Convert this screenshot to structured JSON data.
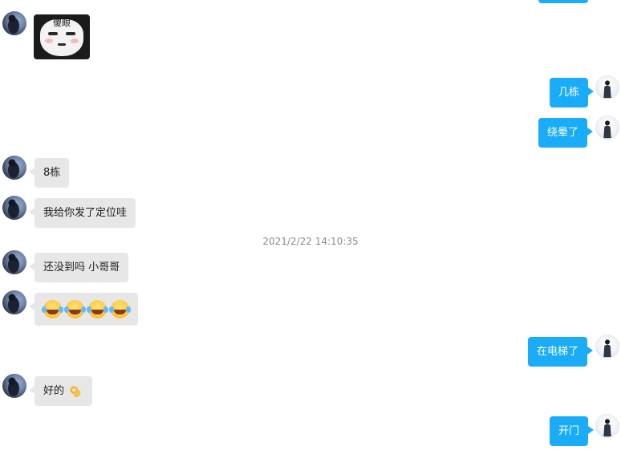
{
  "messages": {
    "m1_sticker_text": "傻眼",
    "m2_text": "几栋",
    "m3_text": "绕晕了",
    "m4_text": "8栋",
    "m5_text": "我给你发了定位哇",
    "timestamp": "2021/2/22 14:10:35",
    "m6_text": "还没到吗 小哥哥",
    "m7_emoji_count": 4,
    "m8_text": "在电梯了",
    "m9_text": "好的",
    "m10_text": "开门"
  },
  "colors": {
    "outgoing_bubble": "#1aacf6",
    "incoming_bubble": "#e7e7e7",
    "timestamp_text": "#8a8a8a"
  },
  "icons": {
    "avatar_incoming": "dark-blue-avatar",
    "avatar_outgoing": "white-avatar-with-person",
    "emoji_laugh": "laugh-tears-emoji",
    "emoji_ok": "ok-hand-emoji"
  }
}
